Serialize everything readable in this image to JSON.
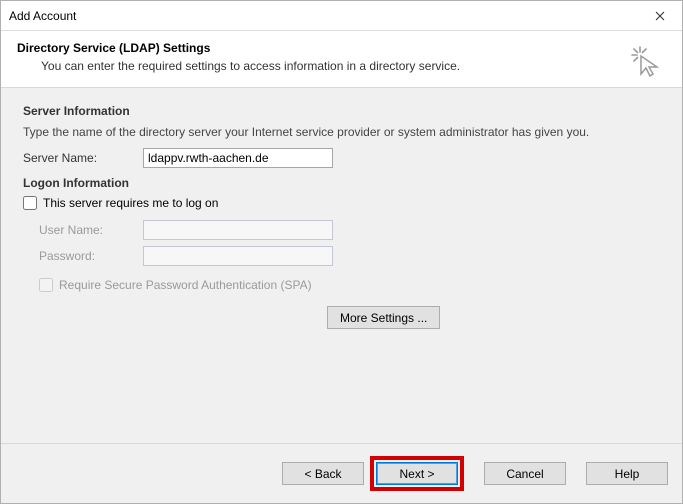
{
  "window": {
    "title": "Add Account"
  },
  "header": {
    "title": "Directory Service (LDAP) Settings",
    "subtitle": "You can enter the required settings to access information in a directory service."
  },
  "server_info": {
    "title": "Server Information",
    "description": "Type the name of the directory server your Internet service provider or system administrator has given you.",
    "server_name_label": "Server Name:",
    "server_name_value": "ldappv.rwth-aachen.de"
  },
  "logon": {
    "title": "Logon Information",
    "requires_logon_label": "This server requires me to log on",
    "requires_logon_checked": false,
    "username_label": "User Name:",
    "username_value": "",
    "password_label": "Password:",
    "password_value": "",
    "spa_label": "Require Secure Password Authentication (SPA)",
    "spa_checked": false
  },
  "buttons": {
    "more_settings": "More Settings ...",
    "back": "< Back",
    "next": "Next >",
    "cancel": "Cancel",
    "help": "Help"
  }
}
